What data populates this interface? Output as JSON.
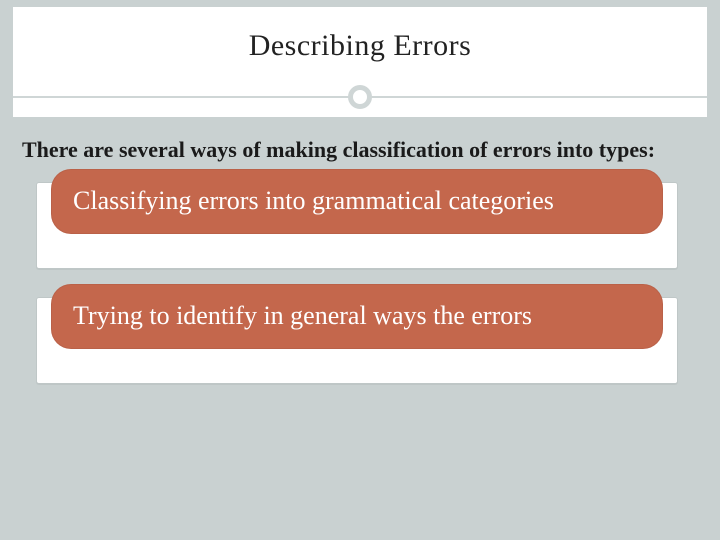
{
  "slide": {
    "title": "Describing Errors",
    "intro": "There are several ways of making classification of errors into types:",
    "cards": [
      {
        "text": "Classifying errors into grammatical categories"
      },
      {
        "text": "Trying to identify in general ways the errors"
      }
    ]
  },
  "colors": {
    "background": "#c9d1d1",
    "accent": "#c4674c",
    "panel": "#ffffff"
  }
}
